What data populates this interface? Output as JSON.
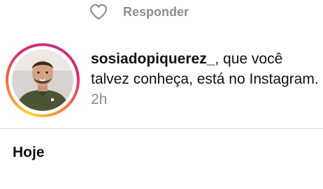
{
  "comment": {
    "like_icon": "heart-outline-icon",
    "reply_label": "Responder"
  },
  "notification": {
    "username": "sosiadopiquerez_",
    "message": ", que você talvez conheça, está no Instagram.",
    "time": "2h",
    "ring_colors": [
      "#fdd835",
      "#f77737",
      "#e1306c",
      "#c13584"
    ]
  },
  "section": {
    "title": "Hoje"
  },
  "colors": {
    "muted_text": "#8e8e8e",
    "divider": "#dbdbdb"
  }
}
